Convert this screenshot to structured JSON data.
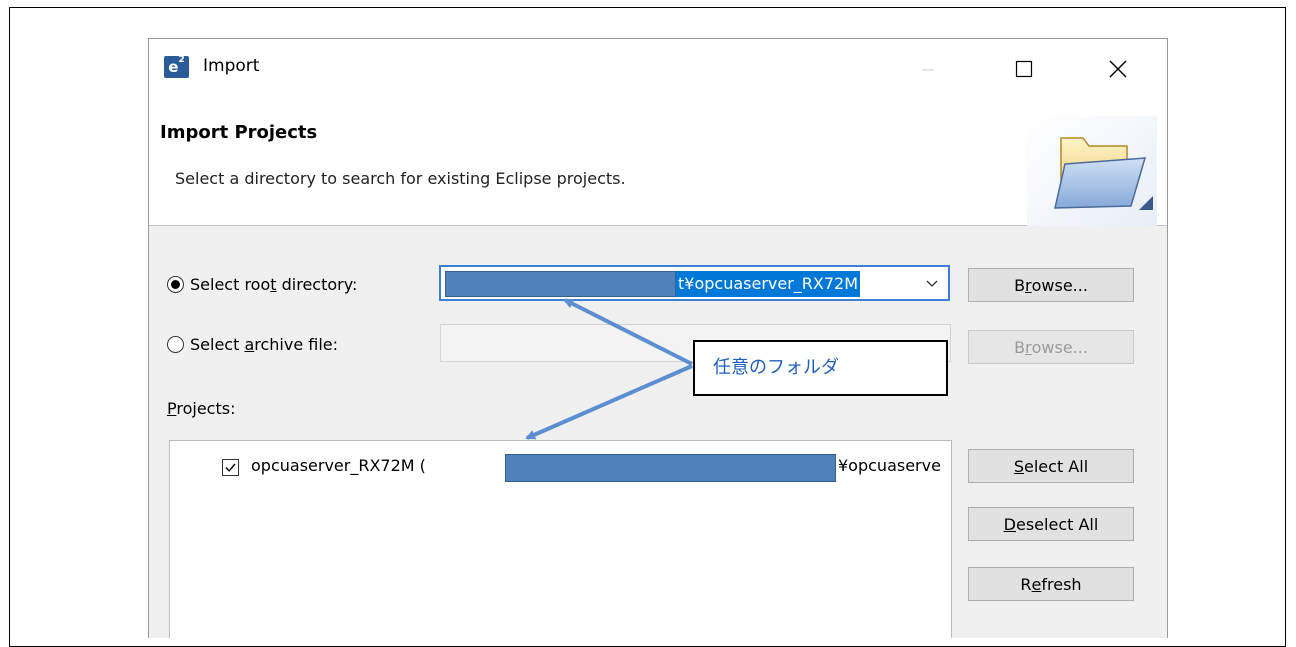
{
  "window": {
    "app_icon_text": "e",
    "app_icon_sup": "2",
    "title": "Import",
    "minimize_icon": "minimize-icon",
    "maximize_icon": "maximize-icon",
    "close_icon": "close-icon"
  },
  "header": {
    "title": "Import Projects",
    "description": "Select a directory to search for existing Eclipse projects.",
    "icon": "folder-icon"
  },
  "root_directory": {
    "label_pre": "Select roo",
    "label_mnemonic": "t",
    "label_post": " directory:",
    "selected": true,
    "value_visible": "t¥opcuaserver_RX72M",
    "browse_pre": "B",
    "browse_mnemonic": "r",
    "browse_post": "owse..."
  },
  "archive_file": {
    "label_pre": "Select ",
    "label_mnemonic": "a",
    "label_post": "rchive file:",
    "selected": false,
    "browse_pre": "B",
    "browse_mnemonic": "r",
    "browse_post": "owse..."
  },
  "projects": {
    "label_mnemonic": "P",
    "label_post": "rojects:",
    "items": [
      {
        "checked": true,
        "name": "opcuaserver_RX72M (",
        "path_end": "¥opcuaserve"
      }
    ]
  },
  "buttons": {
    "select_all_mnemonic": "S",
    "select_all_post": "elect All",
    "deselect_all_mnemonic": "D",
    "deselect_all_post": "eselect All",
    "refresh_pre": "R",
    "refresh_mnemonic": "e",
    "refresh_post": "fresh"
  },
  "annotation": {
    "text": "任意のフォルダ",
    "color": "#1f5fbf",
    "arrow_color": "#5b8fd1"
  },
  "colors": {
    "redaction": "#4f81bd",
    "selection": "#0078d7",
    "focus_border": "#3c7fd7"
  }
}
